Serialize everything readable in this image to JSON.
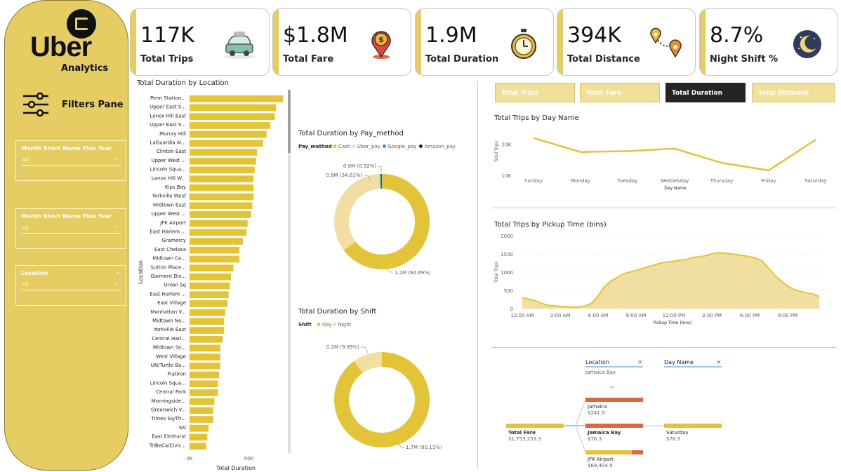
{
  "brand": {
    "logo_text": "Uber",
    "subtitle": "Analytics"
  },
  "filters": {
    "label": "Filters Pane",
    "slicers": [
      {
        "title": "Month Short Name Plus Year",
        "value": "All"
      },
      {
        "title": "Month Short Name Plus Year",
        "value": "All"
      },
      {
        "title": "Location",
        "value": "All"
      }
    ]
  },
  "kpis": [
    {
      "value": "117K",
      "label": "Total Trips",
      "icon": "car-icon"
    },
    {
      "value": "$1.8M",
      "label": "Total Fare",
      "icon": "money-pin-icon"
    },
    {
      "value": "1.9M",
      "label": "Total Duration",
      "icon": "stopwatch-icon"
    },
    {
      "value": "394K",
      "label": "Total Distance",
      "icon": "route-icon"
    },
    {
      "value": "8.7%",
      "label": "Night Shift %",
      "icon": "moon-icon"
    }
  ],
  "buttons": [
    {
      "label": "Total Trips",
      "active": false
    },
    {
      "label": "Total Fare",
      "active": false
    },
    {
      "label": "Total Duration",
      "active": true
    },
    {
      "label": "Total Distance",
      "active": false
    }
  ],
  "colors": {
    "gold": "#e3c338",
    "light_gold": "#f0dfa0",
    "pane": "#e5cd63",
    "accent_orange": "#e2653d"
  },
  "chart_data": [
    {
      "type": "bar",
      "title": "Total Duration by Location",
      "xlabel": "Total Duration",
      "ylabel": "Location",
      "x_ticks": [
        "0K",
        "50K"
      ],
      "xlim": [
        0,
        80000
      ],
      "categories": [
        "Penn Station...",
        "Upper East S...",
        "Lenox Hill East",
        "Upper East S...",
        "Murray Hill",
        "LaGuardia Ai...",
        "Clinton East",
        "Upper West ...",
        "Lincoln Squa...",
        "Lenox Hill W...",
        "Kips Bay",
        "Yorkville West",
        "Midtown East",
        "Upper West ...",
        "JFK Airport",
        "East Harlem ...",
        "Gramercy",
        "East Chelsea",
        "Midtown Ce...",
        "Sutton Place...",
        "Garment Dis...",
        "Union Sq",
        "East Harlem ...",
        "East Village",
        "Manhattan V...",
        "Midtown No...",
        "Yorkville East",
        "Central Harl...",
        "Midtown So...",
        "West Village",
        "UN/Turtle Ba...",
        "Flatiron",
        "Lincoln Squa...",
        "Central Park",
        "Morningside...",
        "Greenwich V...",
        "Times Sq/Th...",
        "NV",
        "East Elmhurst",
        "TriBeCa/Civic..."
      ],
      "values": [
        79000,
        73000,
        72000,
        68000,
        65000,
        62000,
        57000,
        56000,
        55000,
        54000,
        54000,
        54000,
        53000,
        52000,
        49000,
        48000,
        45000,
        42000,
        42000,
        37000,
        35000,
        34000,
        33000,
        32000,
        30000,
        29000,
        29000,
        28000,
        26000,
        26000,
        26000,
        25000,
        24000,
        24000,
        21000,
        20000,
        20000,
        16000,
        15000,
        14000
      ]
    },
    {
      "type": "pie",
      "title": "Total Duration by Pay_method",
      "legend_title": "Pay_method",
      "slices": [
        {
          "label": "Cash",
          "value": 64.69,
          "display": "1.2M (64.69%)",
          "color": "#e3c338"
        },
        {
          "label": "Uber_pay",
          "value": 34.61,
          "display": "0.6M (34.61%)",
          "color": "#f0dfa0"
        },
        {
          "label": "Google_pay",
          "value": 0.52,
          "display": "0.0M (0.52%)",
          "color": "#3b8fdd"
        },
        {
          "label": "Amazon_pay",
          "value": 0.18,
          "display": "",
          "color": "#252423"
        }
      ]
    },
    {
      "type": "pie",
      "title": "Total Duration by Shift",
      "legend_title": "Shift",
      "slices": [
        {
          "label": "Day",
          "value": 90.11,
          "display": "1.7M (90.11%)",
          "color": "#e3c338"
        },
        {
          "label": "Night",
          "value": 9.89,
          "display": "0.2M (9.89%)",
          "color": "#f0dfa0"
        }
      ]
    },
    {
      "type": "line",
      "title": "Total Trips by Day Name",
      "xlabel": "Day Name",
      "ylabel": "Total Trips",
      "categories": [
        "Sunday",
        "Monday",
        "Tuesday",
        "Wednesday",
        "Thursday",
        "Friday",
        "Saturday"
      ],
      "values": [
        22000,
        17500,
        17800,
        18600,
        14000,
        11600,
        21500
      ],
      "y_ticks": [
        "20K",
        "10K"
      ],
      "ylim": [
        10000,
        24000
      ]
    },
    {
      "type": "area",
      "title": "Total Trips by Pickup Time (bins)",
      "xlabel": "Pickup Time (bins)",
      "ylabel": "Total Trips",
      "x_ticks": [
        "12:00 AM",
        "3:00 AM",
        "6:00 AM",
        "9:00 AM",
        "12:00 PM",
        "3:00 PM",
        "6:00 PM",
        "9:00 PM"
      ],
      "y_ticks": [
        "2000",
        "1500",
        "1000",
        "500",
        "0"
      ],
      "ylim": [
        0,
        2000
      ],
      "x_hours": [
        0,
        0.5,
        1,
        1.5,
        2,
        2.5,
        3,
        3.5,
        4,
        4.5,
        5,
        5.5,
        6,
        6.5,
        7,
        7.5,
        8,
        8.5,
        9,
        9.5,
        10,
        10.5,
        11,
        11.5,
        12,
        12.5,
        13,
        13.5,
        14,
        14.5,
        15,
        15.5,
        16,
        16.5,
        17,
        17.5,
        18,
        18.5,
        19,
        19.5,
        20,
        20.5,
        21,
        21.5,
        22,
        22.5,
        23,
        23.5
      ],
      "values": [
        300,
        260,
        220,
        150,
        90,
        80,
        60,
        50,
        40,
        45,
        70,
        150,
        350,
        600,
        750,
        850,
        950,
        1000,
        1050,
        1100,
        1150,
        1200,
        1250,
        1280,
        1300,
        1330,
        1350,
        1400,
        1420,
        1450,
        1500,
        1530,
        1520,
        1500,
        1480,
        1450,
        1420,
        1380,
        1300,
        1100,
        900,
        750,
        620,
        520,
        470,
        430,
        400,
        330
      ]
    }
  ],
  "decomp_tree": {
    "levels": [
      {
        "title": "Location",
        "selected": "Jamaica Bay"
      },
      {
        "title": "Day Name",
        "selected": ""
      }
    ],
    "root": {
      "label": "Total Fare",
      "value": "$1,753,253.3"
    },
    "location_nodes": [
      {
        "label": "Jamaica",
        "value": "$241.9"
      },
      {
        "label": "Jamaica Bay",
        "value": "$76.3"
      },
      {
        "label": "JFK Airport",
        "value": "$69,404.9"
      }
    ],
    "day_nodes": [
      {
        "label": "Saturday",
        "value": "$76.3"
      }
    ]
  }
}
